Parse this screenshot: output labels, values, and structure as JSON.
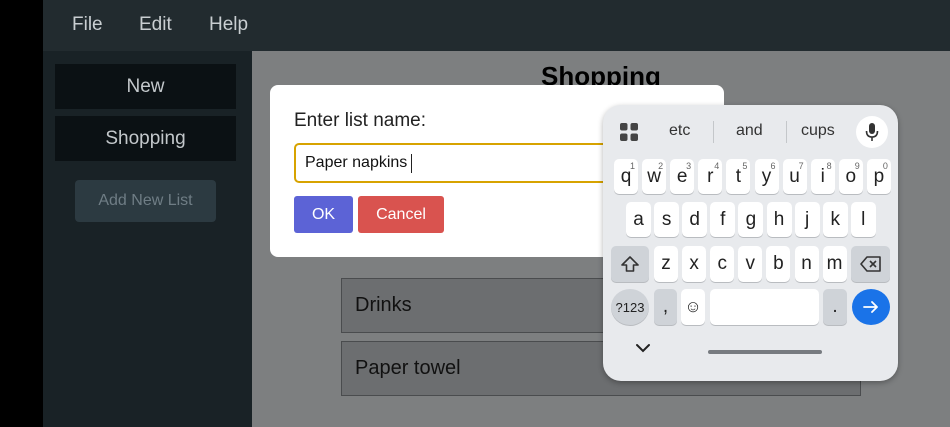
{
  "menubar": {
    "items": [
      "File",
      "Edit",
      "Help"
    ]
  },
  "sidebar": {
    "items": [
      {
        "label": "New"
      },
      {
        "label": "Shopping"
      }
    ],
    "add_button": "Add New List"
  },
  "main": {
    "title": "Shopping",
    "items": [
      {
        "name": "Drinks"
      },
      {
        "name": "Paper towel"
      }
    ]
  },
  "dialog": {
    "label": "Enter list name:",
    "input_value": "Paper napkins",
    "ok": "OK",
    "cancel": "Cancel"
  },
  "keyboard": {
    "suggestions": [
      "etc",
      "and",
      "cups"
    ],
    "rows": [
      [
        {
          "k": "q",
          "s": "1"
        },
        {
          "k": "w",
          "s": "2"
        },
        {
          "k": "e",
          "s": "3"
        },
        {
          "k": "r",
          "s": "4"
        },
        {
          "k": "t",
          "s": "5"
        },
        {
          "k": "y",
          "s": "6"
        },
        {
          "k": "u",
          "s": "7"
        },
        {
          "k": "i",
          "s": "8"
        },
        {
          "k": "o",
          "s": "9"
        },
        {
          "k": "p",
          "s": "0"
        }
      ],
      [
        {
          "k": "a"
        },
        {
          "k": "s"
        },
        {
          "k": "d"
        },
        {
          "k": "f"
        },
        {
          "k": "g"
        },
        {
          "k": "h"
        },
        {
          "k": "j"
        },
        {
          "k": "k"
        },
        {
          "k": "l"
        }
      ],
      [
        {
          "k": "z"
        },
        {
          "k": "x"
        },
        {
          "k": "c"
        },
        {
          "k": "v"
        },
        {
          "k": "b"
        },
        {
          "k": "n"
        },
        {
          "k": "m"
        }
      ]
    ],
    "symbols_key": "?123",
    "comma": ",",
    "period": "."
  },
  "colors": {
    "accent_ok": "#5c63d6",
    "danger": "#d9534f",
    "input_focus": "#d7a300",
    "enter_key": "#1a73e8"
  }
}
